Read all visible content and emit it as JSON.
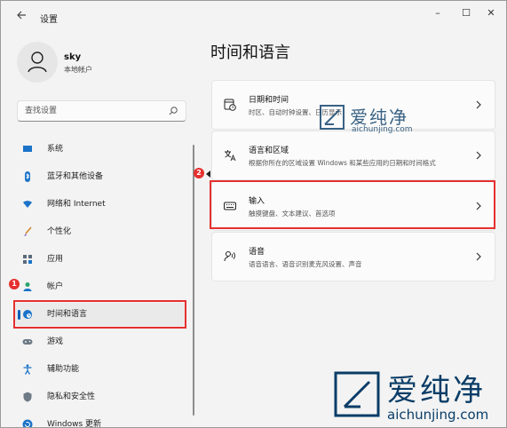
{
  "titlebar": {
    "back_icon": "arrow-left-icon",
    "title": "设置",
    "minimize": "–",
    "maximize": "☐",
    "close": "✕"
  },
  "profile": {
    "name": "sky",
    "account_type": "本地帐户"
  },
  "search": {
    "placeholder": "查找设置"
  },
  "sidebar": {
    "items": [
      {
        "label": "系统",
        "icon": "monitor-icon"
      },
      {
        "label": "蓝牙和其他设备",
        "icon": "bluetooth-icon"
      },
      {
        "label": "网络和 Internet",
        "icon": "wifi-icon"
      },
      {
        "label": "个性化",
        "icon": "brush-icon"
      },
      {
        "label": "应用",
        "icon": "apps-icon"
      },
      {
        "label": "帐户",
        "icon": "person-icon"
      },
      {
        "label": "时间和语言",
        "icon": "globe-clock-icon",
        "selected": true
      },
      {
        "label": "游戏",
        "icon": "gamepad-icon"
      },
      {
        "label": "辅助功能",
        "icon": "accessibility-icon"
      },
      {
        "label": "隐私和安全性",
        "icon": "shield-icon"
      },
      {
        "label": "Windows 更新",
        "icon": "update-icon"
      }
    ]
  },
  "annotations": {
    "badge1": "1",
    "badge2": "2",
    "accent": "#e5302e"
  },
  "main": {
    "title": "时间和语言",
    "cards": [
      {
        "title": "日期和时间",
        "desc": "时区、自动时钟设置、日历显示",
        "icon": "calendar-clock-icon"
      },
      {
        "title": "语言和区域",
        "desc": "根据你所在的区域设置 Windows 和某些应用的日期和时间格式",
        "icon": "language-icon"
      },
      {
        "title": "输入",
        "desc": "触摸键盘、文本建议、首选项",
        "icon": "keyboard-icon"
      },
      {
        "title": "语音",
        "desc": "语音语言、语音识别麦克风设置、声音",
        "icon": "speech-icon"
      }
    ]
  },
  "watermark": {
    "brand": "爱纯净",
    "url": "aichunjing.com",
    "color": "#0a3d67"
  }
}
